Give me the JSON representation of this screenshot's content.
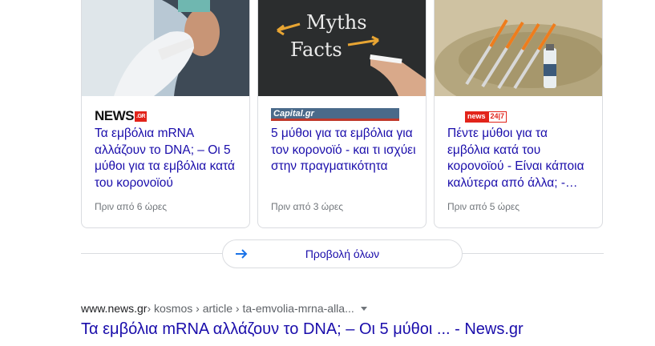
{
  "cards": [
    {
      "source_logo": "NEWS",
      "source_logo_suffix": ".GR",
      "title": "Τα εμβόλια mRNA αλλάζουν το DNA; – Οι 5 μύθοι για τα εμβόλια κατά του κορονοϊού",
      "time": "Πριν από 6 ώρες"
    },
    {
      "source_logo": "Capital.gr",
      "image_text_1": "Myths",
      "image_text_2": "Facts",
      "title": "5 μύθοι για τα εμβόλια για τον κορονοϊό - και τι ισχύει στην πραγματικότητα",
      "time": "Πριν από 3 ώρες"
    },
    {
      "source_logo": "news",
      "source_logo_suffix": "24|7",
      "title": "Πέντε μύθοι για τα εμβόλια κατά του κορονοϊού - Είναι κάποια καλύτερα από άλλα; -…",
      "time": "Πριν από 5 ώρες"
    }
  ],
  "view_all": {
    "label": "Προβολή όλων"
  },
  "result": {
    "domain": "www.news.gr",
    "path": " › kosmos › article › ta-emvolia-mrna-alla...",
    "title": "Τα εμβόλια mRNA αλλάζουν το DNA; – Οι 5 μύθοι ... - News.gr"
  },
  "colors": {
    "link": "#1a0dab",
    "meta": "#70757a",
    "border": "#dadce0"
  }
}
